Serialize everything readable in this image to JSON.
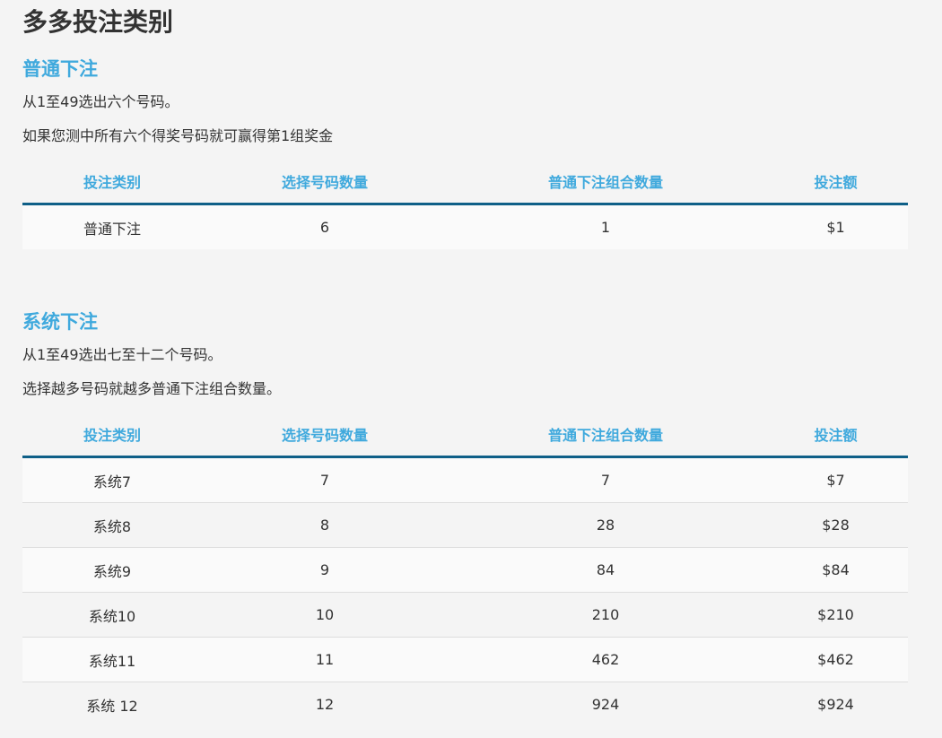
{
  "page": {
    "title": "多多投注类别"
  },
  "columns": [
    "投注类别",
    "选择号码数量",
    "普通下注组合数量",
    "投注额"
  ],
  "sections": [
    {
      "title": "普通下注",
      "desc_1": "从1至49选出六个号码。",
      "desc_2": "如果您测中所有六个得奖号码就可赢得第1组奖金",
      "rows": [
        [
          "普通下注",
          "6",
          "1",
          "$1"
        ]
      ]
    },
    {
      "title": "系统下注",
      "desc_1": "从1至49选出七至十二个号码。",
      "desc_2": "选择越多号码就越多普通下注组合数量。",
      "rows": [
        [
          "系统7",
          "7",
          "7",
          "$7"
        ],
        [
          "系统8",
          "8",
          "28",
          "$28"
        ],
        [
          "系统9",
          "9",
          "84",
          "$84"
        ],
        [
          "系统10",
          "10",
          "210",
          "$210"
        ],
        [
          "系统11",
          "11",
          "462",
          "$462"
        ],
        [
          "系统 12",
          "12",
          "924",
          "$924"
        ]
      ]
    }
  ]
}
